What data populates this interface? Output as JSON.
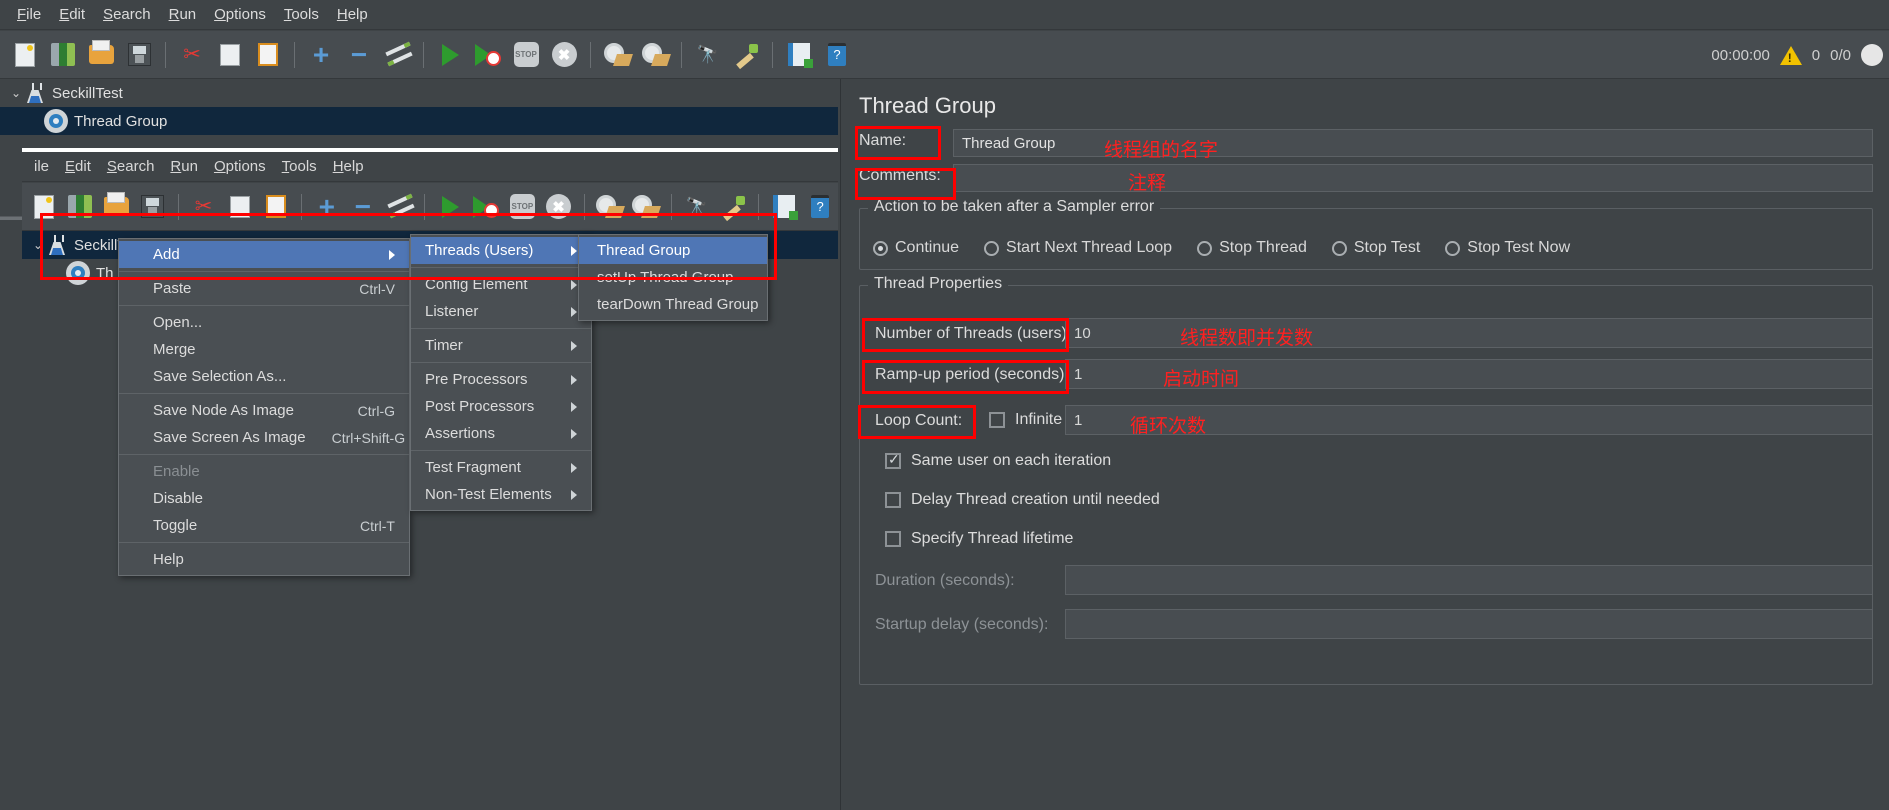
{
  "app": {
    "menubar": [
      "File",
      "Edit",
      "Search",
      "Run",
      "Options",
      "Tools",
      "Help"
    ],
    "status": {
      "timer": "00:00:00",
      "warnings": "0",
      "threads": "0/0"
    }
  },
  "toolbar": {
    "icons": [
      "new-icon",
      "templates-icon",
      "open-icon",
      "save-icon",
      "cut-icon",
      "copy-icon",
      "paste-icon",
      "expand-icon",
      "collapse-icon",
      "toggle-icon",
      "start-icon",
      "start-no-pauses-icon",
      "stop-icon",
      "shutdown-icon",
      "clear-icon",
      "clear-all-icon",
      "search-icon",
      "search-reset-icon",
      "function-helper-icon",
      "help-icon"
    ]
  },
  "tree": {
    "root": {
      "label": "SeckillTest",
      "icon": "test-plan-icon"
    },
    "child": {
      "label": "Thread Group",
      "icon": "thread-group-icon"
    }
  },
  "inner_window": {
    "menubar": [
      "ile",
      "Edit",
      "Search",
      "Run",
      "Options",
      "Tools",
      "Help"
    ],
    "tree": {
      "root": {
        "label": "SeckillTest"
      },
      "child": {
        "label": "Th"
      }
    }
  },
  "context_menu": {
    "items": [
      {
        "label": "Add",
        "shortcut": "",
        "submenu": true,
        "highlight": true,
        "disabled": false
      },
      {
        "label": "Paste",
        "shortcut": "Ctrl-V",
        "submenu": false,
        "highlight": false,
        "disabled": false
      },
      {
        "label": "Open...",
        "shortcut": "",
        "submenu": false,
        "highlight": false,
        "disabled": false
      },
      {
        "label": "Merge",
        "shortcut": "",
        "submenu": false,
        "highlight": false,
        "disabled": false
      },
      {
        "label": "Save Selection As...",
        "shortcut": "",
        "submenu": false,
        "highlight": false,
        "disabled": false
      },
      {
        "label": "Save Node As Image",
        "shortcut": "Ctrl-G",
        "submenu": false,
        "highlight": false,
        "disabled": false
      },
      {
        "label": "Save Screen As Image",
        "shortcut": "Ctrl+Shift-G",
        "submenu": false,
        "highlight": false,
        "disabled": false
      },
      {
        "label": "Enable",
        "shortcut": "",
        "submenu": false,
        "highlight": false,
        "disabled": true
      },
      {
        "label": "Disable",
        "shortcut": "",
        "submenu": false,
        "highlight": false,
        "disabled": false
      },
      {
        "label": "Toggle",
        "shortcut": "Ctrl-T",
        "submenu": false,
        "highlight": false,
        "disabled": false
      },
      {
        "label": "Help",
        "shortcut": "",
        "submenu": false,
        "highlight": false,
        "disabled": false
      }
    ],
    "separators_after": [
      0,
      1,
      4,
      6,
      9
    ]
  },
  "add_submenu": {
    "items": [
      {
        "label": "Threads (Users)",
        "highlight": true
      },
      {
        "label": "Config Element",
        "highlight": false
      },
      {
        "label": "Listener",
        "highlight": false
      },
      {
        "label": "Timer",
        "highlight": false
      },
      {
        "label": "Pre Processors",
        "highlight": false
      },
      {
        "label": "Post Processors",
        "highlight": false
      },
      {
        "label": "Assertions",
        "highlight": false
      },
      {
        "label": "Test Fragment",
        "highlight": false
      },
      {
        "label": "Non-Test Elements",
        "highlight": false
      }
    ],
    "separators_after": [
      0,
      2,
      3,
      6
    ]
  },
  "threads_submenu": {
    "items": [
      {
        "label": "Thread Group",
        "highlight": true
      },
      {
        "label": "setUp Thread Group",
        "highlight": false
      },
      {
        "label": "tearDown Thread Group",
        "highlight": false
      }
    ]
  },
  "panel": {
    "title": "Thread Group",
    "name_label": "Name:",
    "name_value": "Thread Group",
    "comments_label": "Comments:",
    "comments_value": "",
    "sampler_error_group": "Action to be taken after a Sampler error",
    "sampler_error_options": [
      {
        "label": "Continue",
        "selected": true
      },
      {
        "label": "Start Next Thread Loop",
        "selected": false
      },
      {
        "label": "Stop Thread",
        "selected": false
      },
      {
        "label": "Stop Test",
        "selected": false
      },
      {
        "label": "Stop Test Now",
        "selected": false
      }
    ],
    "thread_properties_group": "Thread Properties",
    "num_threads_label": "Number of Threads (users):",
    "num_threads_value": "10",
    "ramp_up_label": "Ramp-up period (seconds):",
    "ramp_up_value": "1",
    "loop_count_label": "Loop Count:",
    "infinite_label": "Infinite",
    "infinite_checked": false,
    "loop_count_value": "1",
    "checkboxes": [
      {
        "label": "Same user on each iteration",
        "checked": true,
        "disabled": false
      },
      {
        "label": "Delay Thread creation until needed",
        "checked": false,
        "disabled": false
      },
      {
        "label": "Specify Thread lifetime",
        "checked": false,
        "disabled": false
      }
    ],
    "duration_label": "Duration (seconds):",
    "duration_value": "",
    "startup_delay_label": "Startup delay (seconds):",
    "startup_delay_value": ""
  },
  "annotations": {
    "accent_color": "#ff0000",
    "notes": [
      {
        "text": "线程组的名字",
        "for": "Name:"
      },
      {
        "text": "注释",
        "for": "Comments:"
      },
      {
        "text": "线程数即并发数",
        "for": "Number of Threads (users):"
      },
      {
        "text": "启动时间",
        "for": "Ramp-up period (seconds):"
      },
      {
        "text": "循环次数",
        "for": "Loop Count:"
      }
    ]
  }
}
